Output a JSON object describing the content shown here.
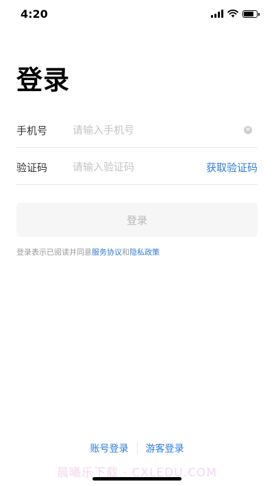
{
  "status_bar": {
    "time": "4:20",
    "icons": [
      "cellular-signal-icon",
      "wifi-icon",
      "battery-icon"
    ],
    "battery_level": 0.9
  },
  "page": {
    "title": "登录"
  },
  "phone_field": {
    "label": "手机号",
    "placeholder": "请输入手机号",
    "value": "",
    "clear_icon": "clear-icon"
  },
  "code_field": {
    "label": "验证码",
    "placeholder": "请输入验证码",
    "value": "",
    "get_code_label": "获取验证码"
  },
  "login_button": {
    "label": "登录"
  },
  "agreement": {
    "prefix": "登录表示已阅读并同意",
    "service_link": "服务协议",
    "conjunction": "和",
    "privacy_link": "隐私政策"
  },
  "bottom_links": {
    "account_login": "账号登录",
    "guest_login": "游客登录"
  },
  "watermark": "晨曦乐下载 · CXLEDU.COM",
  "colors": {
    "accent": "#2f7bd8",
    "button_disabled_bg": "#f6f6f6",
    "button_disabled_text": "#b7b7b7",
    "placeholder": "#c4c4c4",
    "divider": "#e8e8e8"
  }
}
